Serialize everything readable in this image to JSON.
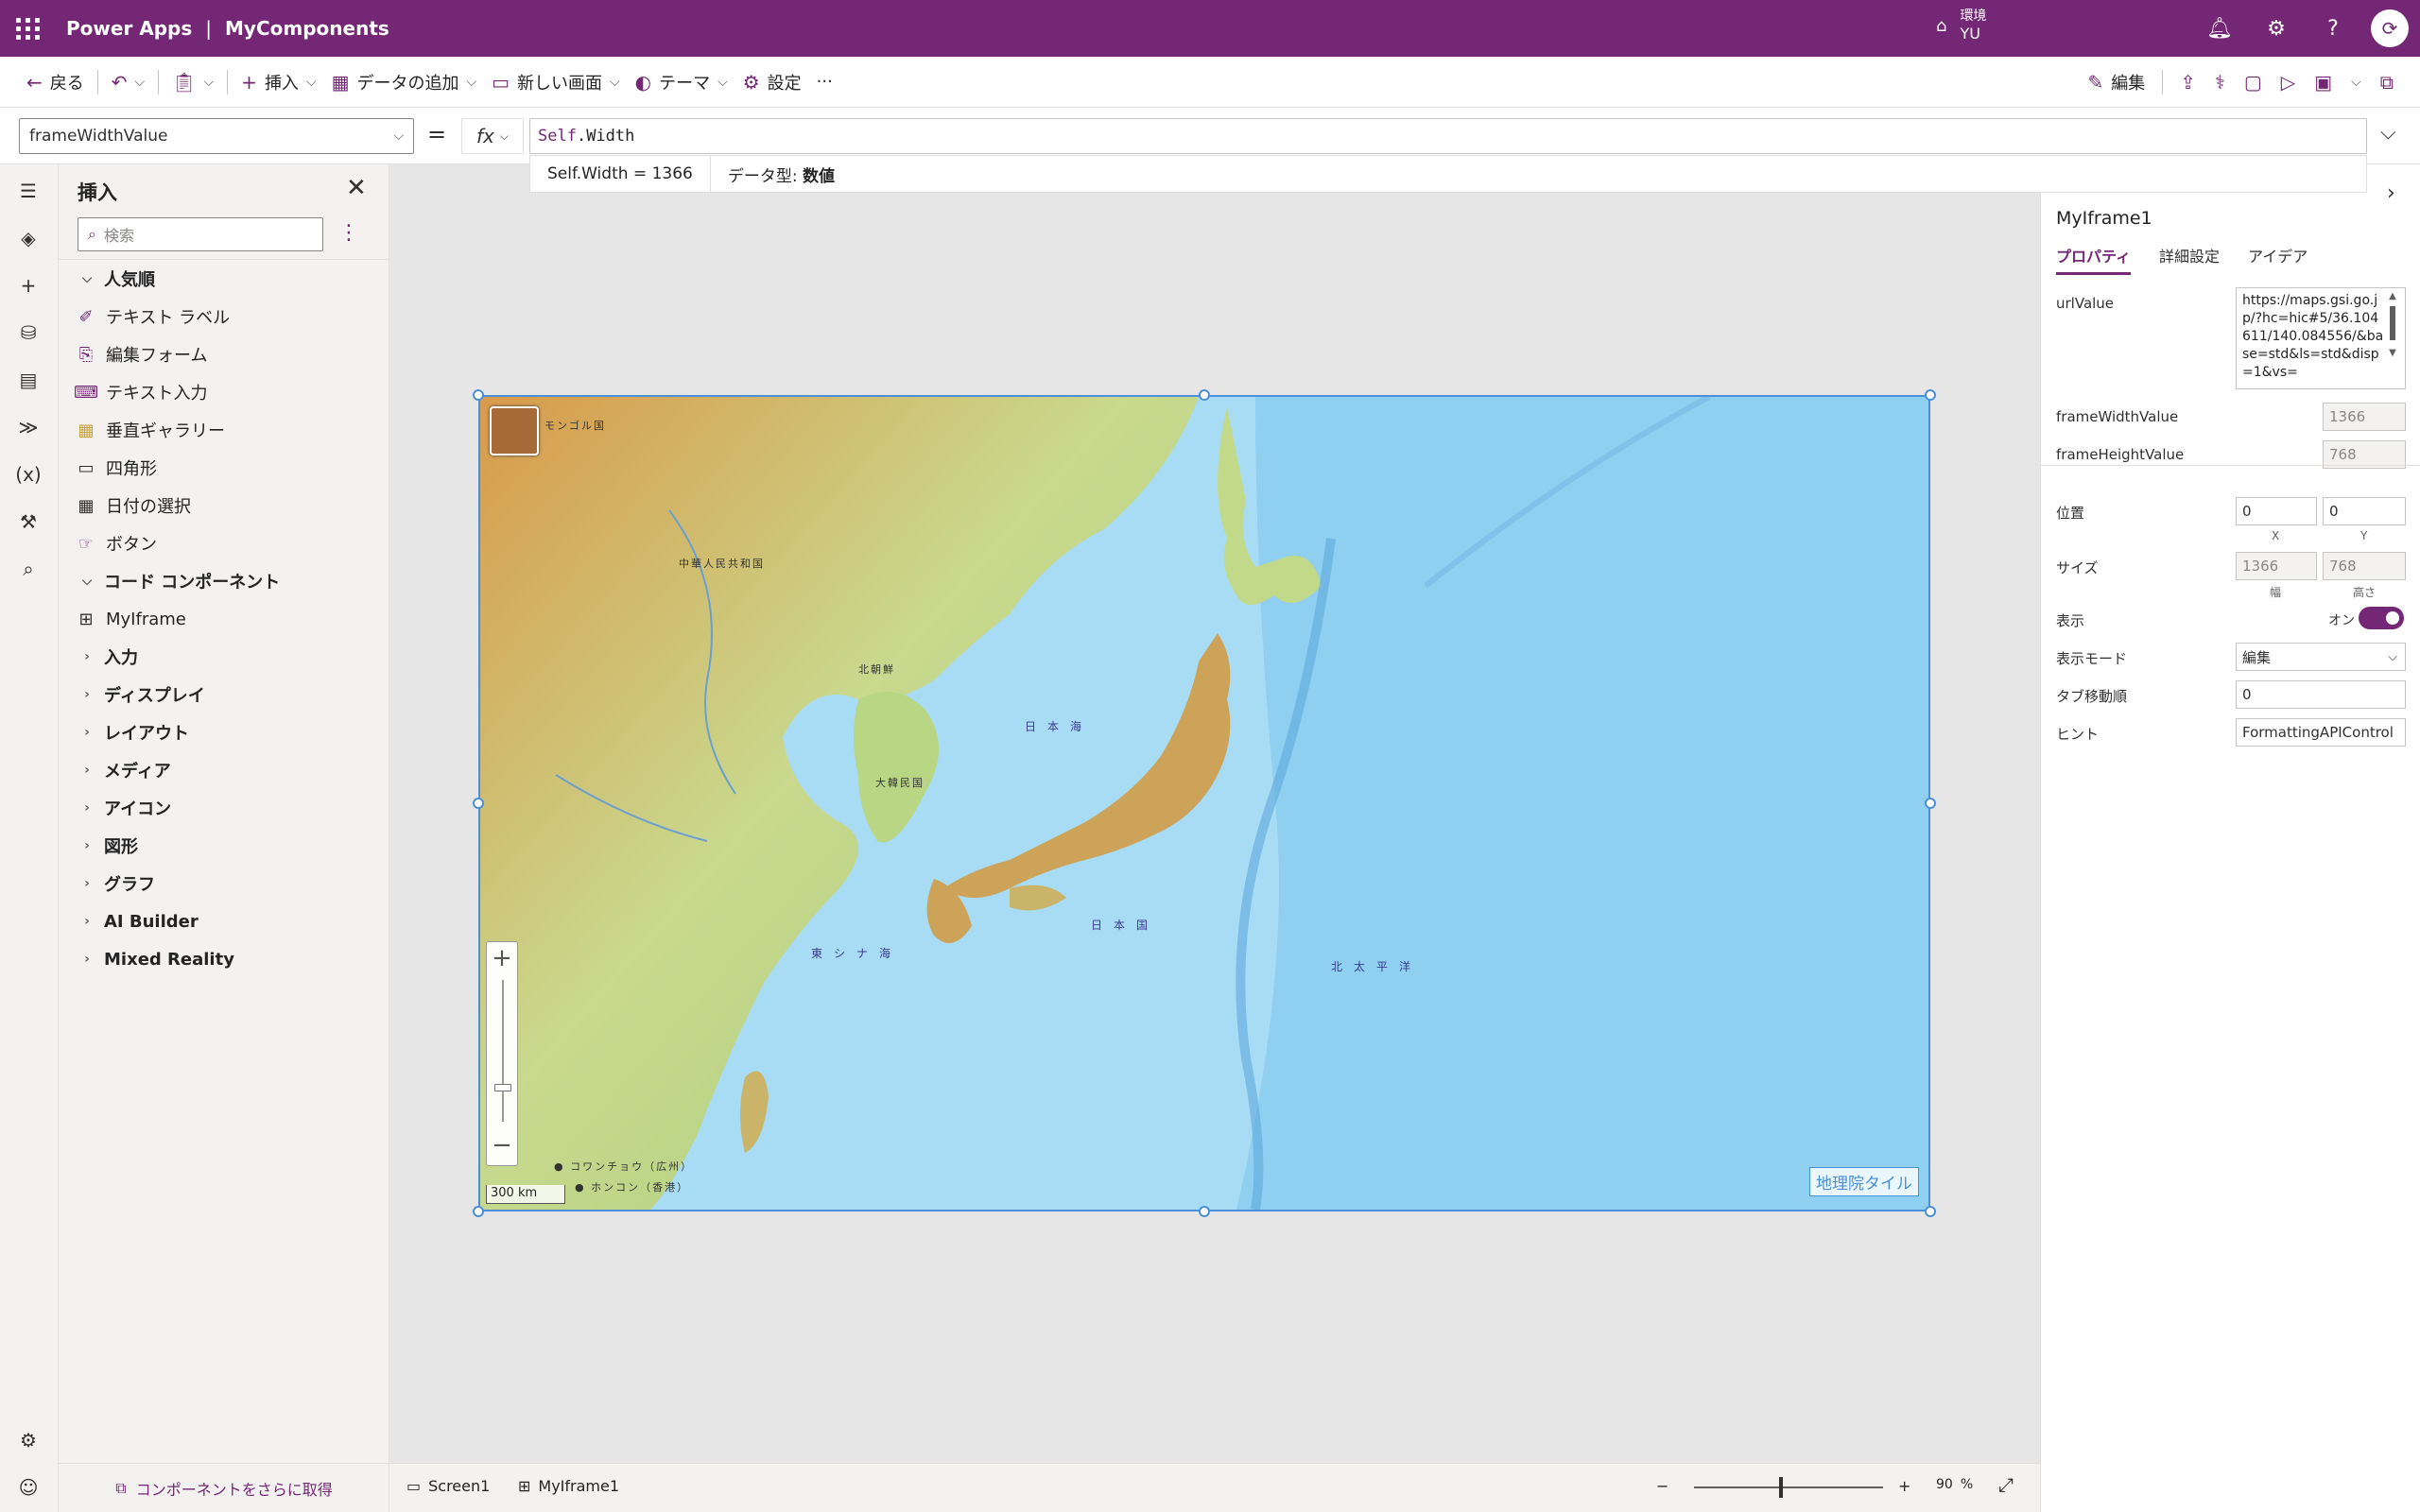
{
  "header": {
    "app_title": "Power Apps",
    "separator": "|",
    "app_name": "MyComponents",
    "environment_label": "環境",
    "environment_value": "YU"
  },
  "commandbar": {
    "back": "戻る",
    "insert": "挿入",
    "add_data": "データの追加",
    "new_screen": "新しい画面",
    "theme": "テーマ",
    "settings": "設定",
    "more": "···",
    "edit": "編集"
  },
  "formula": {
    "property": "frameWidthValue",
    "equals": "=",
    "fx": "fx",
    "expression_keyword": "Self",
    "expression_rest": ".Width",
    "hint_expression": "Self.Width  =  1366",
    "hint_type_label": "データ型:",
    "hint_type_value": "数値"
  },
  "insert_panel": {
    "title": "挿入",
    "search_placeholder": "検索",
    "popular_group": "人気順",
    "popular_items": [
      {
        "label": "テキスト ラベル",
        "icon": "text-label-icon"
      },
      {
        "label": "編集フォーム",
        "icon": "edit-form-icon"
      },
      {
        "label": "テキスト入力",
        "icon": "text-input-icon"
      },
      {
        "label": "垂直ギャラリー",
        "icon": "gallery-icon"
      },
      {
        "label": "四角形",
        "icon": "rectangle-icon"
      },
      {
        "label": "日付の選択",
        "icon": "calendar-icon"
      },
      {
        "label": "ボタン",
        "icon": "button-icon"
      }
    ],
    "code_group": "コード コンポーネント",
    "code_items": [
      {
        "label": "MyIframe",
        "icon": "component-icon"
      }
    ],
    "collapsed_groups": [
      "入力",
      "ディスプレイ",
      "レイアウト",
      "メディア",
      "アイコン",
      "図形",
      "グラフ",
      "AI Builder",
      "Mixed Reality"
    ],
    "get_more": "コンポーネントをさらに取得"
  },
  "map": {
    "attribution": "地理院タイル",
    "scale": "300 km",
    "labels": {
      "japan_sea": "日本海",
      "pacific": "北太平洋",
      "east_china_sea": "東シナ海",
      "japan": "日本国",
      "china": "中華人民共和国",
      "korea_n": "北朝鮮",
      "korea_s": "大韓民国",
      "mongolia": "モンゴル国",
      "hongkong": "● ホンコン（香港）",
      "guangzhou": "● コワンチョウ（広州）"
    }
  },
  "properties": {
    "control_name": "MyIframe1",
    "tabs": [
      "プロパティ",
      "詳細設定",
      "アイデア"
    ],
    "url_label": "urlValue",
    "url_value": "https://maps.gsi.go.jp/?hc=hic#5/36.104611/140.084556/&base=std&ls=std&disp=1&vs=",
    "frame_width_label": "frameWidthValue",
    "frame_width_value": "1366",
    "frame_height_label": "frameHeightValue",
    "frame_height_value": "768",
    "position_label": "位置",
    "position_x": "0",
    "position_y": "0",
    "x_label": "X",
    "y_label": "Y",
    "size_label": "サイズ",
    "size_w": "1366",
    "size_h": "768",
    "w_label": "幅",
    "h_label": "高さ",
    "visible_label": "表示",
    "visible_state": "オン",
    "display_mode_label": "表示モード",
    "display_mode_value": "編集",
    "tab_index_label": "タブ移動順",
    "tab_index_value": "0",
    "tooltip_label": "ヒント",
    "tooltip_value": "FormattingAPIControl"
  },
  "bottom": {
    "screen": "Screen1",
    "component": "MyIframe1",
    "zoom_value": "90",
    "zoom_unit": "%",
    "zoom_minus": "−",
    "zoom_plus": "+"
  },
  "colors": {
    "brand": "#742774",
    "selection": "#4a90d9"
  }
}
